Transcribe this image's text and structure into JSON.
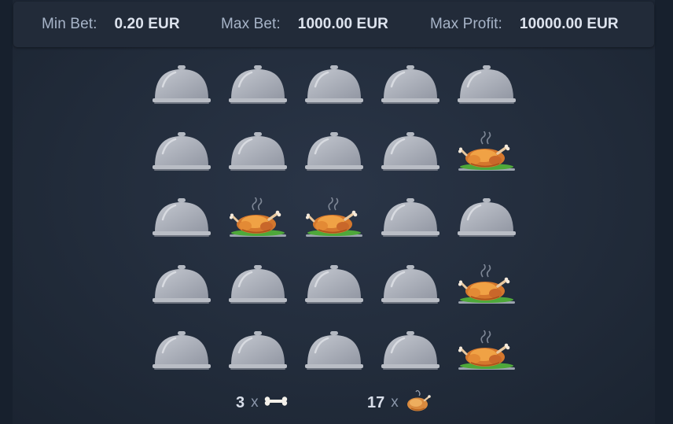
{
  "limits": {
    "min_bet_label": "Min Bet:",
    "min_bet_value": "0.20 EUR",
    "max_bet_label": "Max Bet:",
    "max_bet_value": "1000.00 EUR",
    "max_profit_label": "Max Profit:",
    "max_profit_value": "10000.00 EUR"
  },
  "board": {
    "rows": 5,
    "cols": 5,
    "tiles": [
      [
        "cloche",
        "cloche",
        "cloche",
        "cloche",
        "cloche"
      ],
      [
        "cloche",
        "cloche",
        "cloche",
        "cloche",
        "chicken"
      ],
      [
        "cloche",
        "chicken",
        "chicken",
        "cloche",
        "cloche"
      ],
      [
        "cloche",
        "cloche",
        "cloche",
        "cloche",
        "chicken"
      ],
      [
        "cloche",
        "cloche",
        "cloche",
        "cloche",
        "chicken"
      ]
    ]
  },
  "counters": {
    "bones_count": "3",
    "bones_x": "x",
    "bones_icon": "bone-icon",
    "chickens_count": "17",
    "chickens_x": "x",
    "chickens_icon": "chicken-icon"
  },
  "colors": {
    "background": "#17202d",
    "panel": "#222b39",
    "label": "#a7b4c8",
    "value": "#dde3ee",
    "cloche": "#a9aeb9",
    "chicken": "#f08a2c"
  }
}
